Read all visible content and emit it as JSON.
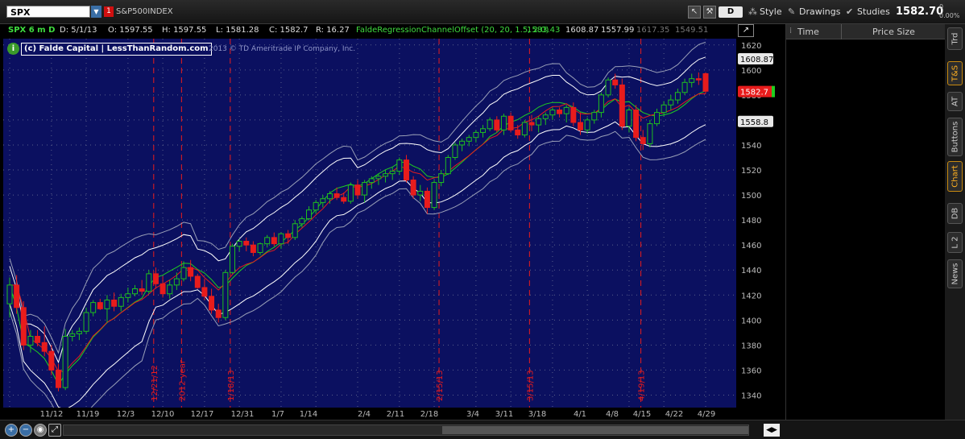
{
  "toolbar": {
    "symbol": "SPX",
    "link_badge": "1",
    "index_name": "S&P500INDEX",
    "period_button": "D",
    "style_label": "Style",
    "drawings_label": "Drawings",
    "studies_label": "Studies",
    "last_price": "1582.70",
    "change_top": "0",
    "change_bottom": "0.00%"
  },
  "info_bar": {
    "symbol_period": "SPX 6 m D",
    "date": "D: 5/1/13",
    "open": "O: 1597.55",
    "high": "H: 1597.55",
    "low": "L: 1581.28",
    "close": "C: 1582.7",
    "range": "R: 16.27",
    "study_name": "FaldeRegressionChannelOffset (20, 20, 1.5, 2.0)",
    "study_v1": "1583.43",
    "study_v2": "1608.87",
    "study_v3": "1557.99",
    "study_v4": "1617.35",
    "study_v5": "1549.51"
  },
  "watermark": {
    "icon": "i",
    "text": "(c) Falde Capital  |  LessThanRandom.com",
    "copyright": "2013 © TD Ameritrade IP Company, Inc."
  },
  "colors": {
    "background": "#0b1060",
    "up_candle": "#1fbf1f",
    "down_candle": "#e81c1c",
    "midline": "#1fcf1f",
    "offset_line": "#e81c1c",
    "inner_band": "#ffffff",
    "outer_band": "#9aa0b8",
    "vline": "#e81c1c"
  },
  "chart_data": {
    "type": "candlestick",
    "ylim": [
      1330,
      1625
    ],
    "y_ticks": [
      1340,
      1360,
      1380,
      1400,
      1420,
      1440,
      1460,
      1480,
      1500,
      1520,
      1540,
      1560,
      1580,
      1600,
      1620
    ],
    "x_tick_labels": [
      "11/12",
      "11/19",
      "12/3",
      "12/10",
      "12/17",
      "12/31",
      "1/7",
      "1/14",
      "2/4",
      "2/11",
      "2/18",
      "3/4",
      "3/11",
      "3/18",
      "4/1",
      "4/8",
      "4/15",
      "4/22",
      "4/29"
    ],
    "price_labels": {
      "upper_band": "1608.87",
      "last": "1582.7",
      "lower_band": "1558.8"
    },
    "event_markers": [
      "12/21/12",
      "2012 year",
      "1/18/13",
      "2/15/13",
      "3/15/13",
      "4/19/13"
    ],
    "ohlc": [
      [
        1413,
        1434,
        1402,
        1428
      ],
      [
        1428,
        1436,
        1405,
        1410
      ],
      [
        1410,
        1415,
        1376,
        1380
      ],
      [
        1380,
        1392,
        1374,
        1387
      ],
      [
        1387,
        1392,
        1379,
        1382
      ],
      [
        1382,
        1395,
        1371,
        1375
      ],
      [
        1375,
        1380,
        1356,
        1360
      ],
      [
        1360,
        1365,
        1343,
        1346
      ],
      [
        1346,
        1393,
        1344,
        1387
      ],
      [
        1387,
        1392,
        1383,
        1389
      ],
      [
        1389,
        1394,
        1384,
        1391
      ],
      [
        1391,
        1410,
        1389,
        1406
      ],
      [
        1406,
        1416,
        1403,
        1414
      ],
      [
        1414,
        1417,
        1408,
        1409
      ],
      [
        1409,
        1420,
        1398,
        1416
      ],
      [
        1416,
        1422,
        1407,
        1411
      ],
      [
        1411,
        1421,
        1407,
        1418
      ],
      [
        1418,
        1426,
        1414,
        1421
      ],
      [
        1421,
        1428,
        1419,
        1425
      ],
      [
        1425,
        1432,
        1420,
        1423
      ],
      [
        1423,
        1440,
        1421,
        1437
      ],
      [
        1437,
        1442,
        1425,
        1429
      ],
      [
        1429,
        1435,
        1418,
        1421
      ],
      [
        1421,
        1432,
        1417,
        1428
      ],
      [
        1428,
        1438,
        1424,
        1433
      ],
      [
        1433,
        1447,
        1431,
        1442
      ],
      [
        1442,
        1448,
        1431,
        1435
      ],
      [
        1435,
        1437,
        1425,
        1426
      ],
      [
        1426,
        1433,
        1416,
        1419
      ],
      [
        1419,
        1425,
        1405,
        1408
      ],
      [
        1408,
        1413,
        1398,
        1402
      ],
      [
        1402,
        1440,
        1400,
        1438
      ],
      [
        1438,
        1461,
        1437,
        1459
      ],
      [
        1459,
        1465,
        1455,
        1463
      ],
      [
        1463,
        1466,
        1455,
        1460
      ],
      [
        1460,
        1463,
        1451,
        1454
      ],
      [
        1454,
        1462,
        1452,
        1461
      ],
      [
        1461,
        1468,
        1458,
        1466
      ],
      [
        1466,
        1470,
        1459,
        1461
      ],
      [
        1461,
        1470,
        1457,
        1469
      ],
      [
        1469,
        1472,
        1461,
        1466
      ],
      [
        1466,
        1480,
        1464,
        1477
      ],
      [
        1477,
        1483,
        1474,
        1481
      ],
      [
        1481,
        1491,
        1480,
        1488
      ],
      [
        1488,
        1496,
        1485,
        1494
      ],
      [
        1494,
        1500,
        1490,
        1497
      ],
      [
        1497,
        1503,
        1493,
        1501
      ],
      [
        1501,
        1506,
        1496,
        1498
      ],
      [
        1498,
        1502,
        1493,
        1495
      ],
      [
        1495,
        1510,
        1493,
        1508
      ],
      [
        1508,
        1512,
        1497,
        1500
      ],
      [
        1500,
        1512,
        1494,
        1510
      ],
      [
        1510,
        1515,
        1505,
        1513
      ],
      [
        1513,
        1517,
        1508,
        1515
      ],
      [
        1515,
        1520,
        1510,
        1517
      ],
      [
        1517,
        1522,
        1512,
        1519
      ],
      [
        1519,
        1530,
        1516,
        1528
      ],
      [
        1528,
        1532,
        1510,
        1512
      ],
      [
        1512,
        1515,
        1497,
        1500
      ],
      [
        1500,
        1508,
        1495,
        1503
      ],
      [
        1503,
        1506,
        1485,
        1490
      ],
      [
        1490,
        1512,
        1488,
        1510
      ],
      [
        1510,
        1520,
        1507,
        1517
      ],
      [
        1517,
        1532,
        1516,
        1530
      ],
      [
        1530,
        1542,
        1528,
        1540
      ],
      [
        1540,
        1545,
        1535,
        1543
      ],
      [
        1543,
        1548,
        1539,
        1546
      ],
      [
        1546,
        1552,
        1542,
        1550
      ],
      [
        1550,
        1556,
        1546,
        1553
      ],
      [
        1553,
        1562,
        1551,
        1560
      ],
      [
        1560,
        1563,
        1550,
        1552
      ],
      [
        1552,
        1565,
        1548,
        1563
      ],
      [
        1563,
        1566,
        1550,
        1552
      ],
      [
        1552,
        1556,
        1545,
        1548
      ],
      [
        1548,
        1560,
        1546,
        1558
      ],
      [
        1558,
        1564,
        1551,
        1556
      ],
      [
        1556,
        1563,
        1550,
        1561
      ],
      [
        1561,
        1566,
        1556,
        1564
      ],
      [
        1564,
        1570,
        1560,
        1568
      ],
      [
        1568,
        1570,
        1562,
        1565
      ],
      [
        1565,
        1572,
        1558,
        1570
      ],
      [
        1570,
        1574,
        1555,
        1558
      ],
      [
        1558,
        1566,
        1548,
        1552
      ],
      [
        1552,
        1562,
        1549,
        1560
      ],
      [
        1560,
        1568,
        1557,
        1566
      ],
      [
        1566,
        1582,
        1562,
        1580
      ],
      [
        1580,
        1594,
        1578,
        1592
      ],
      [
        1592,
        1597,
        1585,
        1588
      ],
      [
        1588,
        1593,
        1552,
        1555
      ],
      [
        1555,
        1570,
        1550,
        1568
      ],
      [
        1568,
        1572,
        1543,
        1546
      ],
      [
        1546,
        1552,
        1536,
        1541
      ],
      [
        1541,
        1560,
        1538,
        1557
      ],
      [
        1557,
        1569,
        1555,
        1566
      ],
      [
        1566,
        1575,
        1563,
        1572
      ],
      [
        1572,
        1580,
        1568,
        1576
      ],
      [
        1576,
        1585,
        1573,
        1582
      ],
      [
        1582,
        1593,
        1580,
        1590
      ],
      [
        1590,
        1597,
        1586,
        1593
      ],
      [
        1593,
        1598,
        1588,
        1592
      ],
      [
        1597,
        1598,
        1581,
        1583
      ]
    ]
  }
}
